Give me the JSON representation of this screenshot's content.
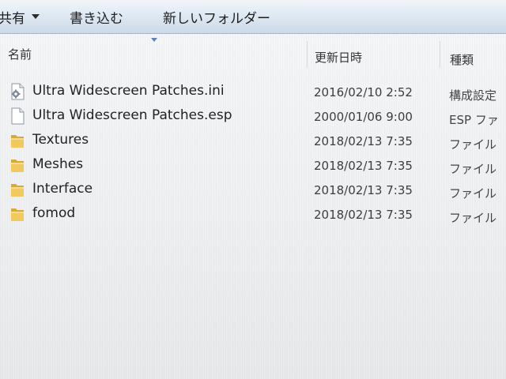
{
  "toolbar": {
    "share_label": "共有",
    "burn_label": "書き込む",
    "new_folder_label": "新しいフォルダー"
  },
  "columns": {
    "name": "名前",
    "date_modified": "更新日時",
    "type": "種類"
  },
  "files": [
    {
      "name": "Ultra Widescreen Patches.ini",
      "date": "2016/02/10 2:52",
      "type": "構成設定",
      "icon": "settings-file-icon"
    },
    {
      "name": "Ultra Widescreen Patches.esp",
      "date": "2000/01/06 9:00",
      "type": "ESP ファ",
      "icon": "document-file-icon"
    },
    {
      "name": "Textures",
      "date": "2018/02/13 7:35",
      "type": "ファイル",
      "icon": "folder-icon"
    },
    {
      "name": "Meshes",
      "date": "2018/02/13 7:35",
      "type": "ファイル",
      "icon": "folder-icon"
    },
    {
      "name": "Interface",
      "date": "2018/02/13 7:35",
      "type": "ファイル",
      "icon": "folder-icon"
    },
    {
      "name": "fomod",
      "date": "2018/02/13 7:35",
      "type": "ファイル",
      "icon": "folder-icon"
    }
  ],
  "colors": {
    "toolbar_top": "#f2f6fb",
    "toolbar_bottom": "#cdd9e7",
    "folder_yellow": "#e8b94a",
    "sort_caret": "#5b83b3"
  }
}
